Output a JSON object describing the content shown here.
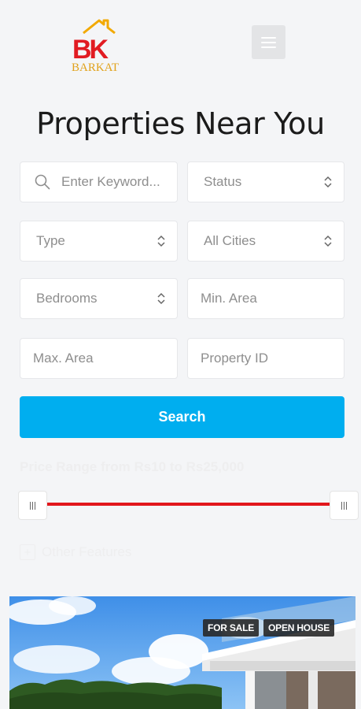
{
  "brand": {
    "name": "BARKAT",
    "initials": "BK",
    "tagline": ""
  },
  "menu": {
    "icon": "hamburger-menu-icon"
  },
  "page": {
    "title": "Properties Near You"
  },
  "search_form": {
    "keyword": {
      "placeholder": "Enter Keyword...",
      "icon": "search-icon"
    },
    "status": {
      "value": "Status"
    },
    "type": {
      "value": "Type"
    },
    "cities": {
      "value": "All Cities"
    },
    "bedrooms": {
      "value": "Bedrooms"
    },
    "min_area": {
      "placeholder": "Min. Area"
    },
    "max_area": {
      "placeholder": "Max. Area"
    },
    "property_id": {
      "placeholder": "Property ID"
    },
    "search_button": "Search",
    "price_range": {
      "label": "Price Range",
      "text": "Price Range from Rs10 to Rs25,000",
      "min": 10,
      "max": 25000,
      "min_fraction": 0,
      "max_fraction": 1
    },
    "other_features": {
      "label": "Other Features",
      "icon": "plus-square-icon"
    }
  },
  "listing": {
    "badges": [
      "FOR SALE",
      "OPEN HOUSE"
    ]
  },
  "colors": {
    "accent": "#00aeef",
    "slider": "#e2171c",
    "logo_red": "#e11b22",
    "logo_gold": "#f2a900",
    "badge_bg": "#2b2b2b"
  }
}
